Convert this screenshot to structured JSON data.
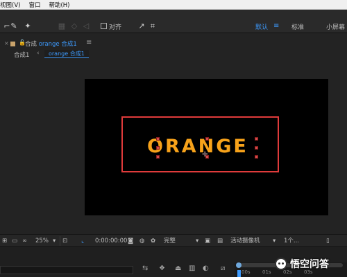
{
  "menubar": {
    "items": [
      "视图(V)",
      "窗口",
      "帮助(H)"
    ]
  },
  "toolbar": {
    "snap_label": "对齐",
    "workspaces": [
      "默认",
      "标准",
      "小屏幕"
    ],
    "active_workspace": "默认"
  },
  "comp_panel": {
    "tab_prefix": "合成",
    "tab_name": "orange 合成1",
    "breadcrumb_parent": "合成1",
    "breadcrumb_active": "orange 合成1"
  },
  "canvas": {
    "text": "ORANGE",
    "text_color": "#f7a21a",
    "box_color": "#e03b3b",
    "background": "#000000"
  },
  "viewer_bar": {
    "zoom": "25%",
    "timecode": "0:00:00:00",
    "resolution": "完整",
    "camera": "活动摄像机",
    "views": "1个..."
  },
  "timeline": {
    "ruler_labels": [
      "00s",
      "01s",
      "02s",
      "03s"
    ]
  },
  "watermark": {
    "text": "悟空问答"
  },
  "colors": {
    "accent": "#3d9bff"
  }
}
